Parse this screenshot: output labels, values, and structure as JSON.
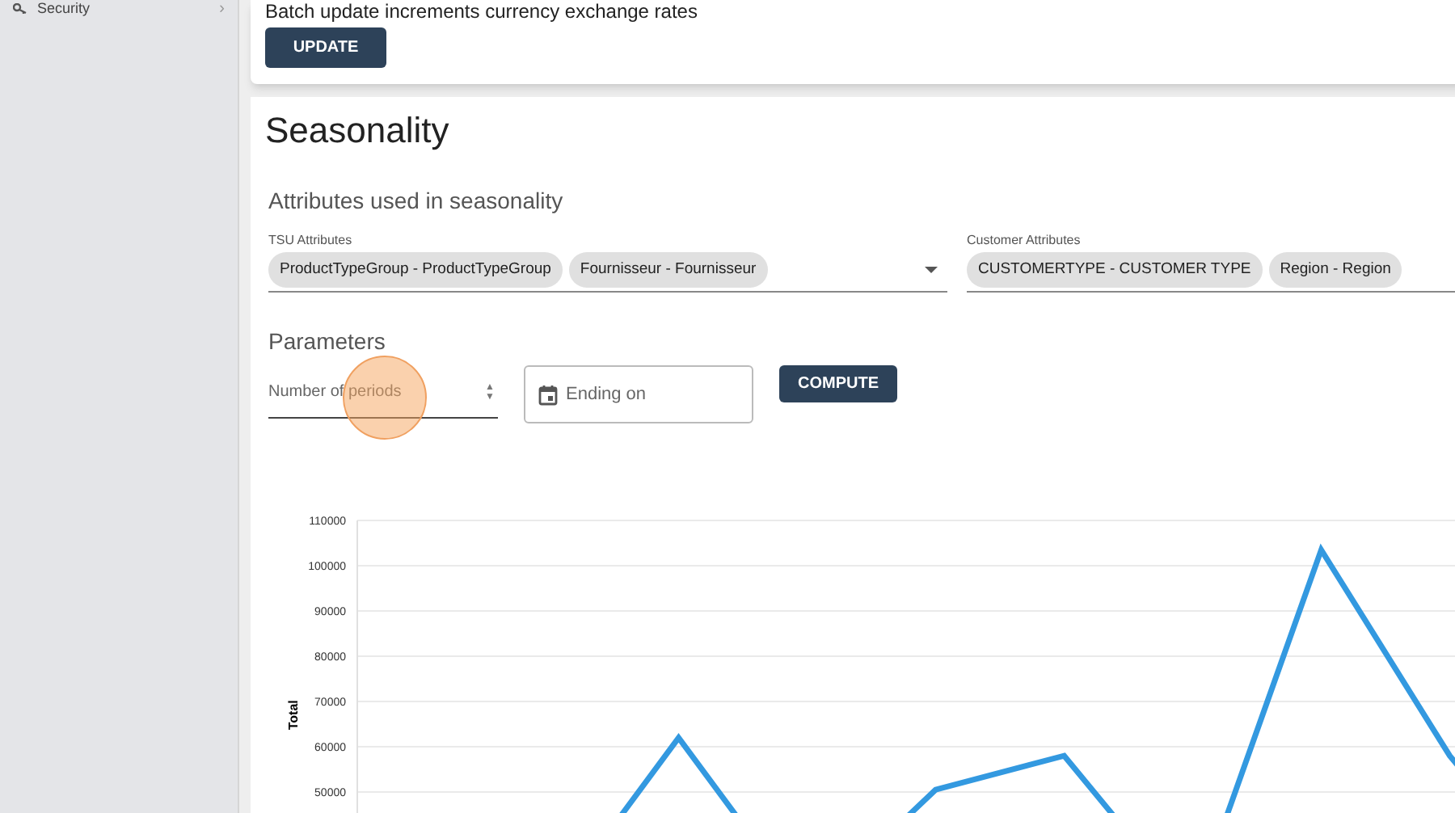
{
  "sidebar": {
    "items": [
      {
        "label": "Security",
        "chevron": "›",
        "expanded": false
      }
    ]
  },
  "update_card": {
    "description": "Batch update increments currency exchange rates",
    "button": "UPDATE"
  },
  "seasonality": {
    "title": "Seasonality",
    "attributes_heading": "Attributes used in seasonality",
    "tsu_attributes": {
      "label": "TSU Attributes",
      "chips": [
        "ProductTypeGroup - ProductTypeGroup",
        "Fournisseur - Fournisseur"
      ]
    },
    "customer_attributes": {
      "label": "Customer Attributes",
      "chips": [
        "CUSTOMERTYPE - CUSTOMER TYPE",
        "Region - Region"
      ]
    },
    "parameters_heading": "Parameters",
    "periods_field": {
      "placeholder": "Number of periods",
      "spin_up": "▲",
      "spin_down": "▼"
    },
    "ending_field": {
      "placeholder": "Ending on"
    },
    "compute_button": "COMPUTE",
    "chart_data": {
      "type": "line",
      "grid": true,
      "ylim": [
        45000,
        110000
      ],
      "yticks": [
        50000,
        60000,
        70000,
        80000,
        90000,
        100000,
        110000
      ],
      "categories": [
        null,
        null,
        null,
        null,
        null,
        null,
        null,
        null,
        null,
        null
      ],
      "series": [
        {
          "name": "Total",
          "color": "#3399e0",
          "values": [
            null,
            null,
            62000,
            null,
            50500,
            58000,
            null,
            103500,
            58000,
            null
          ]
        }
      ]
    }
  }
}
